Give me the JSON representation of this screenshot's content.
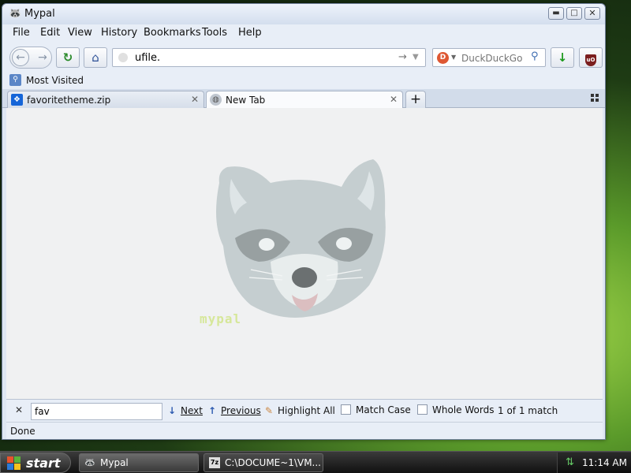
{
  "window": {
    "title": "Mypal",
    "controls": {
      "minimize": "▬",
      "maximize": "□",
      "close": "✕"
    }
  },
  "menu": [
    "File",
    "Edit",
    "View",
    "History",
    "Bookmarks",
    "Tools",
    "Help"
  ],
  "navbar": {
    "url_value": "ufile.",
    "search_placeholder": "DuckDuckGo",
    "search_engine_icon": "duckduckgo-icon",
    "icons": {
      "back": "←",
      "forward": "→",
      "reload": "↻",
      "home": "⌂",
      "go": "→",
      "url_dropdown": "▼",
      "engine_dropdown": "▼",
      "search_go": "⚲",
      "download": "↓",
      "ublock": "uO"
    }
  },
  "bookmarks_bar": {
    "most_visited": "Most Visited"
  },
  "tabs": [
    {
      "label": "favoritetheme.zip",
      "icon": "dropbox-icon",
      "selected": false
    },
    {
      "label": "New Tab",
      "icon": "globe-icon",
      "selected": true
    }
  ],
  "tab_close_glyph": "✕",
  "new_tab_glyph": "+",
  "content": {
    "logo_text": "mypal"
  },
  "findbar": {
    "close": "✕",
    "query": "fav",
    "next": "Next",
    "previous": "Previous",
    "highlight_all": "Highlight All",
    "match_case": "Match Case",
    "whole_words": "Whole Words",
    "status": "1 of 1 match"
  },
  "statusbar": {
    "text": "Done"
  },
  "taskbar": {
    "start": "start",
    "tasks": [
      {
        "label": "Mypal",
        "icon": "mypal-icon"
      },
      {
        "label": "C:\\DOCUME~1\\VM...",
        "icon": "7zip-icon",
        "icon_text": "7z"
      }
    ],
    "clock": "11:14 AM"
  },
  "colors": {
    "window_chrome": "#dfe7f3",
    "content_bg": "#f0f1f2",
    "accent_green": "#2a8a2a",
    "accent_blue": "#2c4f96"
  }
}
